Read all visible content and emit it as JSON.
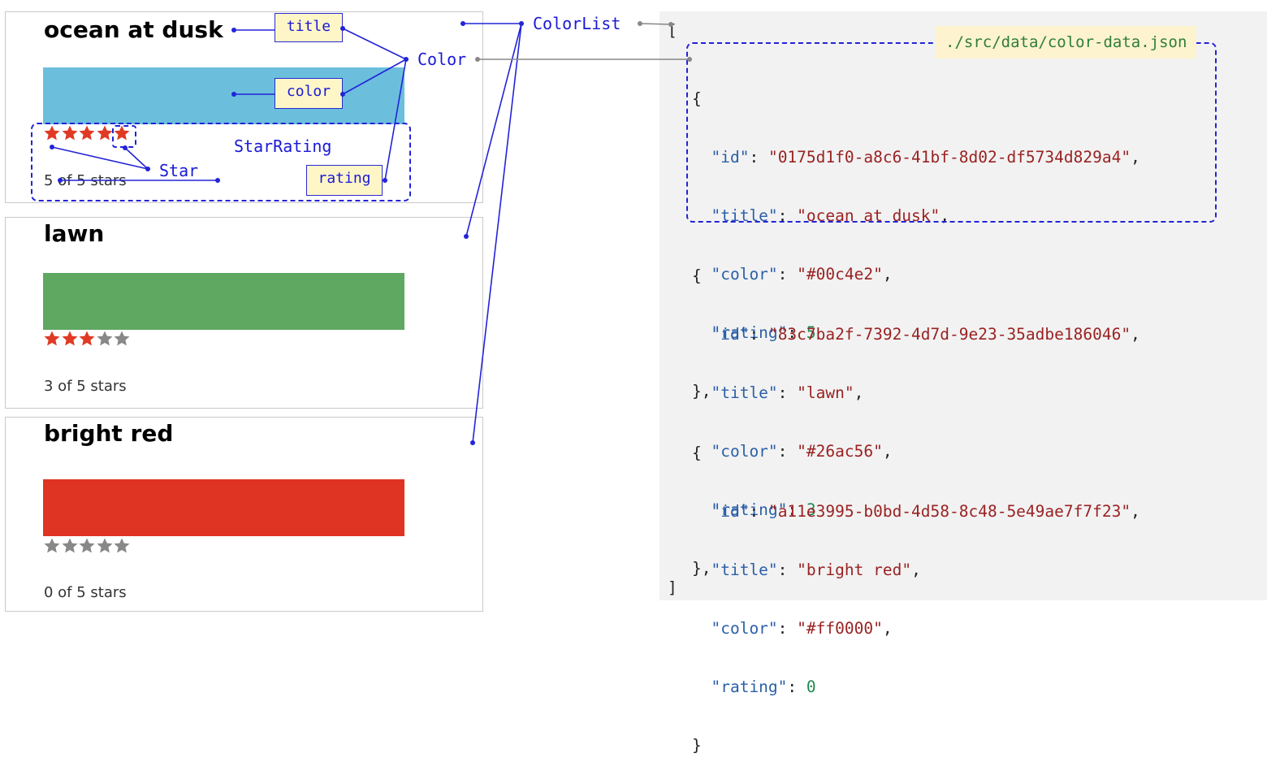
{
  "colors": [
    {
      "title": "ocean at dusk",
      "color_value": "#6bbfdd",
      "rating": 5,
      "stars_text": "5 of 5 stars"
    },
    {
      "title": "lawn",
      "color_value": "#5fa862",
      "rating": 3,
      "stars_text": "3 of 5 stars"
    },
    {
      "title": "bright red",
      "color_value": "#df3323",
      "rating": 0,
      "stars_text": "0 of 5 stars"
    }
  ],
  "star_colors": {
    "filled": "#e03a25",
    "empty": "#888888"
  },
  "annotations": {
    "title_box": "title",
    "color_box": "color",
    "rating_box": "rating",
    "color_label": "Color",
    "colorlist_label": "ColorList",
    "starrating_label": "StarRating",
    "star_label": "Star",
    "file_label": "./src/data/color-data.json",
    "accent": "#2323d8"
  },
  "json_source": {
    "open_bracket": "[",
    "close_bracket": "]",
    "items": [
      {
        "id": "0175d1f0-a8c6-41bf-8d02-df5734d829a4",
        "title": "ocean at dusk",
        "color": "#00c4e2",
        "rating": "5",
        "close": "},"
      },
      {
        "id": "83c7ba2f-7392-4d7d-9e23-35adbe186046",
        "title": "lawn",
        "color": "#26ac56",
        "rating": "3",
        "close": "},"
      },
      {
        "id": "a11e3995-b0bd-4d58-8c48-5e49ae7f7f23",
        "title": "bright red",
        "color": "#ff0000",
        "rating": "0",
        "close": "}"
      }
    ]
  }
}
